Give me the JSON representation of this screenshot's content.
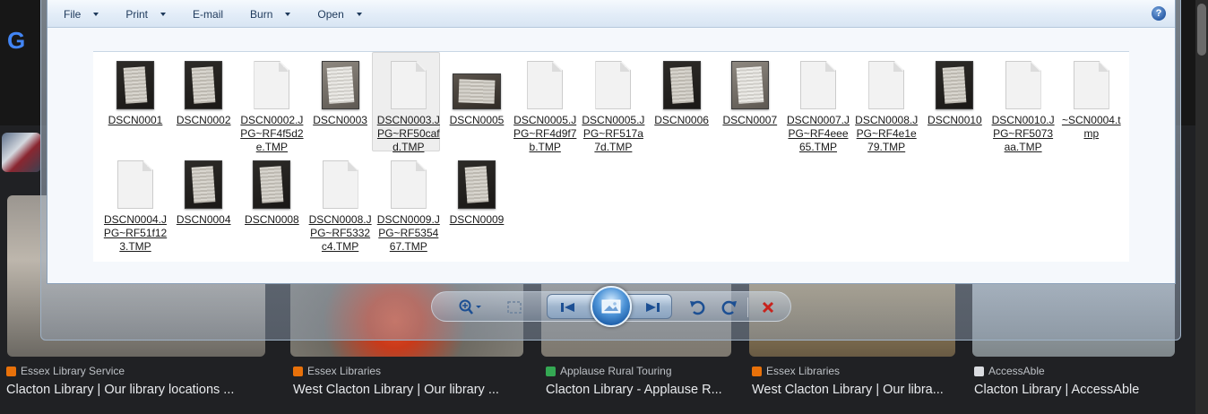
{
  "background": {
    "logo_letter": "G",
    "results": [
      {
        "source": "Essex Library Service",
        "title": "Clacton Library | Our library locations ...",
        "fav_color": "#e8710a"
      },
      {
        "source": "Essex Libraries",
        "title": "West Clacton Library | Our library ...",
        "fav_color": "#e8710a"
      },
      {
        "source": "Applause Rural Touring",
        "title": "Clacton Library - Applause R...",
        "fav_color": "#34a853",
        "fav_letter": "a"
      },
      {
        "source": "Essex Libraries",
        "title": "West Clacton Library | Our libra...",
        "fav_color": "#e8710a"
      },
      {
        "source": "AccessAble",
        "title": "Clacton Library | AccessAble",
        "fav_color": "#dadce0"
      }
    ]
  },
  "photo_viewer": {
    "menu": {
      "file": "File",
      "print": "Print",
      "email": "E-mail",
      "burn": "Burn",
      "open": "Open"
    },
    "help_label": "?",
    "files": [
      {
        "name": "DSCN0001",
        "type": "photo"
      },
      {
        "name": "DSCN0002",
        "type": "photo"
      },
      {
        "name": "DSCN0002.JPG~RF4f5d2e.TMP",
        "type": "doc"
      },
      {
        "name": "DSCN0003",
        "type": "photo-light"
      },
      {
        "name": "DSCN0003.JPG~RF50cafd.TMP",
        "type": "doc",
        "selected": true
      },
      {
        "name": "DSCN0005",
        "type": "photo-wide"
      },
      {
        "name": "DSCN0005.JPG~RF4d9f7b.TMP",
        "type": "doc"
      },
      {
        "name": "DSCN0005.JPG~RF517a7d.TMP",
        "type": "doc"
      },
      {
        "name": "DSCN0006",
        "type": "photo"
      },
      {
        "name": "DSCN0007",
        "type": "photo-light"
      },
      {
        "name": "DSCN0007.JPG~RF4eee65.TMP",
        "type": "doc"
      },
      {
        "name": "DSCN0008.JPG~RF4e1e79.TMP",
        "type": "doc"
      },
      {
        "name": "DSCN0010",
        "type": "photo"
      },
      {
        "name": "DSCN0010.JPG~RF5073aa.TMP",
        "type": "doc"
      },
      {
        "name": "~SCN0004.tmp",
        "type": "doc"
      },
      {
        "name": "DSCN0004.JPG~RF51f123.TMP",
        "type": "doc"
      },
      {
        "name": "DSCN0004",
        "type": "photo"
      },
      {
        "name": "DSCN0008",
        "type": "photo"
      },
      {
        "name": "DSCN0008.JPG~RF5332c4.TMP",
        "type": "doc"
      },
      {
        "name": "DSCN0009.JPG~RF535467.TMP",
        "type": "doc"
      },
      {
        "name": "DSCN0009",
        "type": "photo"
      }
    ],
    "toolbar": {
      "zoom": "zoom-icon",
      "fit": "actual-size-icon",
      "previous": "previous-icon",
      "slideshow": "slideshow-icon",
      "next": "next-icon",
      "rotate_ccw": "rotate-counterclockwise-icon",
      "rotate_cw": "rotate-clockwise-icon",
      "delete": "delete-icon"
    }
  }
}
